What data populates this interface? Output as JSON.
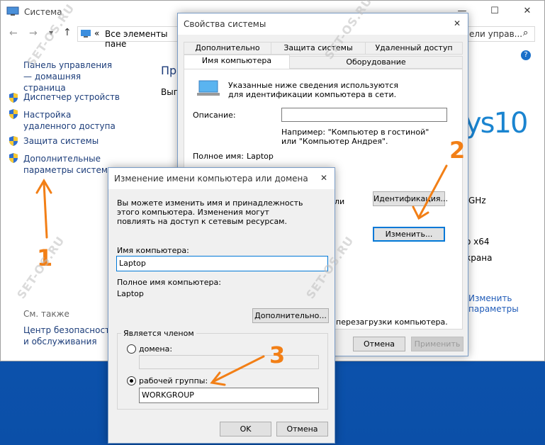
{
  "system_window": {
    "title": "Система",
    "address": "Все элементы пане",
    "address_right": "ели управ...",
    "controls": [
      "—",
      "☐",
      "✕"
    ],
    "sidebar": {
      "home_link": "Панель управления — домашняя страница",
      "items": [
        {
          "label": "Диспетчер устройств"
        },
        {
          "label": "Настройка удаленного доступа"
        },
        {
          "label": "Защита системы"
        },
        {
          "label": "Дополнительные параметры системы"
        }
      ],
      "see_also": "См. также",
      "security_link": "Центр безопасности и обслуживания"
    },
    "main_heading_partial": "Про",
    "main_line_partial": "Вып",
    "win_logo_text": "ys10",
    "right_texts": [
      "GHz",
      "o x64",
      "крана"
    ],
    "change_links": [
      "Изменить",
      "параметры"
    ],
    "help_icon": "?"
  },
  "sysprops": {
    "title": "Свойства системы",
    "close": "✕",
    "tabs_top": [
      "Дополнительно",
      "Защита системы",
      "Удаленный доступ"
    ],
    "tabs_bottom": [
      "Имя компьютера",
      "Оборудование"
    ],
    "info_text": "Указанные ниже сведения используются для идентификации компьютера в сети.",
    "description_label": "Описание:",
    "description_value": "",
    "example_text": "Например: \"Компьютер в гостиной\" или \"Компьютер Андрея\".",
    "fullname_label": "Полное имя:",
    "fullname_value": "Laptop",
    "partial_label": "ли",
    "partial_label2": "",
    "identification_button": "Идентификация...",
    "change_button": "Изменить...",
    "restart_note": "перезагрузки компьютера.",
    "cancel_button": "Отмена",
    "apply_button": "Применить"
  },
  "rename_dialog": {
    "title": "Изменение имени компьютера или домена",
    "close": "✕",
    "intro": "Вы можете изменить имя и принадлежность этого компьютера. Изменения могут повлиять на доступ к сетевым ресурсам.",
    "computer_name_label": "Имя компьютера:",
    "computer_name_value": "Laptop",
    "full_name_label": "Полное имя компьютера:",
    "full_name_value": "Laptop",
    "more_button": "Дополнительно...",
    "member_of_label": "Является членом",
    "domain_label": "домена:",
    "domain_value": "",
    "workgroup_label": "рабочей группы:",
    "workgroup_value": "WORKGROUP",
    "ok_button": "OK",
    "cancel_button": "Отмена"
  },
  "annotations": {
    "step1": "1",
    "step2": "2",
    "step3": "3",
    "watermark": "SET-OS.RU",
    "arrow_color": "#f27f16"
  }
}
